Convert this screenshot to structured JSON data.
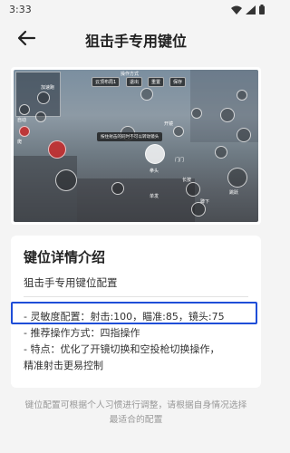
{
  "status_bar": {
    "time": "3:33"
  },
  "header": {
    "title": "狙击手专用键位"
  },
  "preview": {
    "top_buttons": [
      "云顶布局1",
      "退出",
      "重置",
      "保存"
    ],
    "top_caption": "操作方式",
    "tip": "按住射击的同时不可以转动镜头",
    "labels": [
      "开镜",
      "门门",
      "拳头",
      "单发",
      "长按",
      "蹲下",
      "跳跃",
      "自动",
      "爬",
      "加速跑"
    ]
  },
  "details": {
    "title": "键位详情介绍",
    "subtitle": "狙击手专用键位配置",
    "lines": [
      "- 灵敏度配置：射击:100，瞄准:85，镜头:75",
      "- 推荐操作方式：四指操作",
      "- 特点：优化了开镜切换和空投枪切换操作，",
      "精准射击更易控制"
    ]
  },
  "footer": {
    "note_line1": "键位配置可根据个人习惯进行调整，请根据自身情况选择",
    "note_line2": "最适合的配置"
  }
}
